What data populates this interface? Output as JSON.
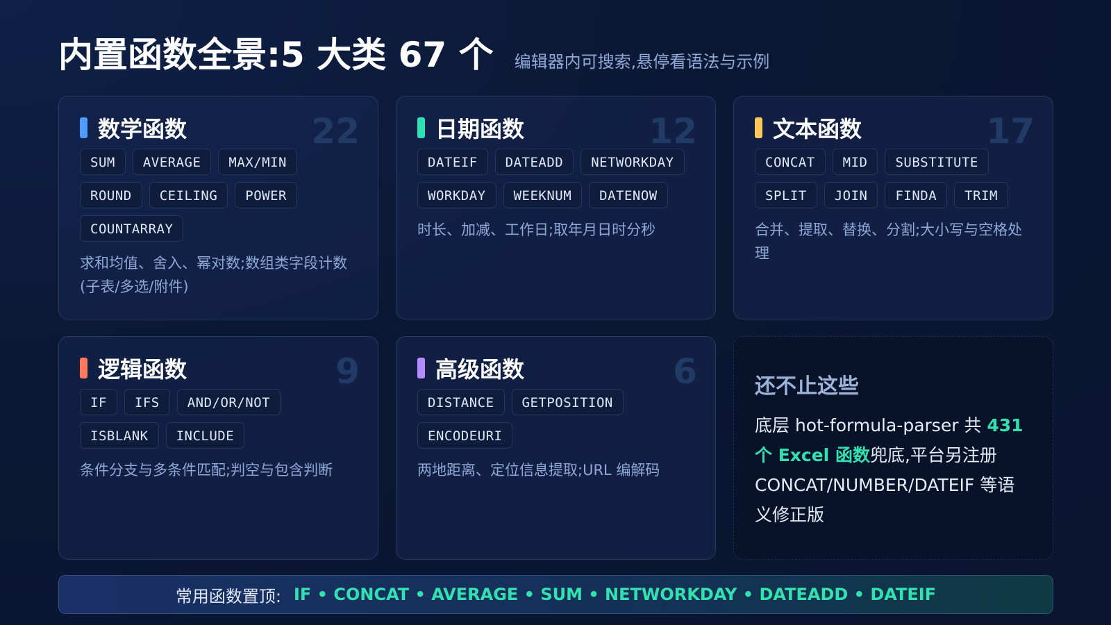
{
  "header": {
    "title": "内置函数全景:5 大类 67 个",
    "subtitle": "编辑器内可搜索,悬停看语法与示例"
  },
  "colors": {
    "math": "#4f9bff",
    "date": "#2ee0b6",
    "text": "#ffc85a",
    "logic": "#ff7a5c",
    "advanced": "#b58cff",
    "highlight": "#33e0b0"
  },
  "cards": {
    "math": {
      "title": "数学函数",
      "count": "22",
      "tags": [
        "SUM",
        "AVERAGE",
        "MAX/MIN",
        "ROUND",
        "CEILING",
        "POWER",
        "COUNTARRAY"
      ],
      "desc": "求和均值、舍入、幂对数;数组类字段计数(子表/多选/附件)"
    },
    "date": {
      "title": "日期函数",
      "count": "12",
      "tags": [
        "DATEIF",
        "DATEADD",
        "NETWORKDAY",
        "WORKDAY",
        "WEEKNUM",
        "DATENOW"
      ],
      "desc": "时长、加减、工作日;取年月日时分秒"
    },
    "text": {
      "title": "文本函数",
      "count": "17",
      "tags": [
        "CONCAT",
        "MID",
        "SUBSTITUTE",
        "SPLIT",
        "JOIN",
        "FINDA",
        "TRIM"
      ],
      "desc": "合并、提取、替换、分割;大小写与空格处理"
    },
    "logic": {
      "title": "逻辑函数",
      "count": "9",
      "tags": [
        "IF",
        "IFS",
        "AND/OR/NOT",
        "ISBLANK",
        "INCLUDE"
      ],
      "desc": "条件分支与多条件匹配;判空与包含判断"
    },
    "advanced": {
      "title": "高级函数",
      "count": "6",
      "tags": [
        "DISTANCE",
        "GETPOSITION",
        "ENCODEURI"
      ],
      "desc": "两地距离、定位信息提取;URL 编解码"
    }
  },
  "note": {
    "title": "还不止这些",
    "text_before": "底层 hot-formula-parser 共 ",
    "highlight": "431 个 Excel 函数",
    "text_after": "兜底,平台另注册 CONCAT/NUMBER/DATEIF 等语义修正版"
  },
  "bottom": {
    "label": "常用函数置顶:",
    "list": "IF • CONCAT • AVERAGE • SUM • NETWORKDAY • DATEADD • DATEIF"
  }
}
